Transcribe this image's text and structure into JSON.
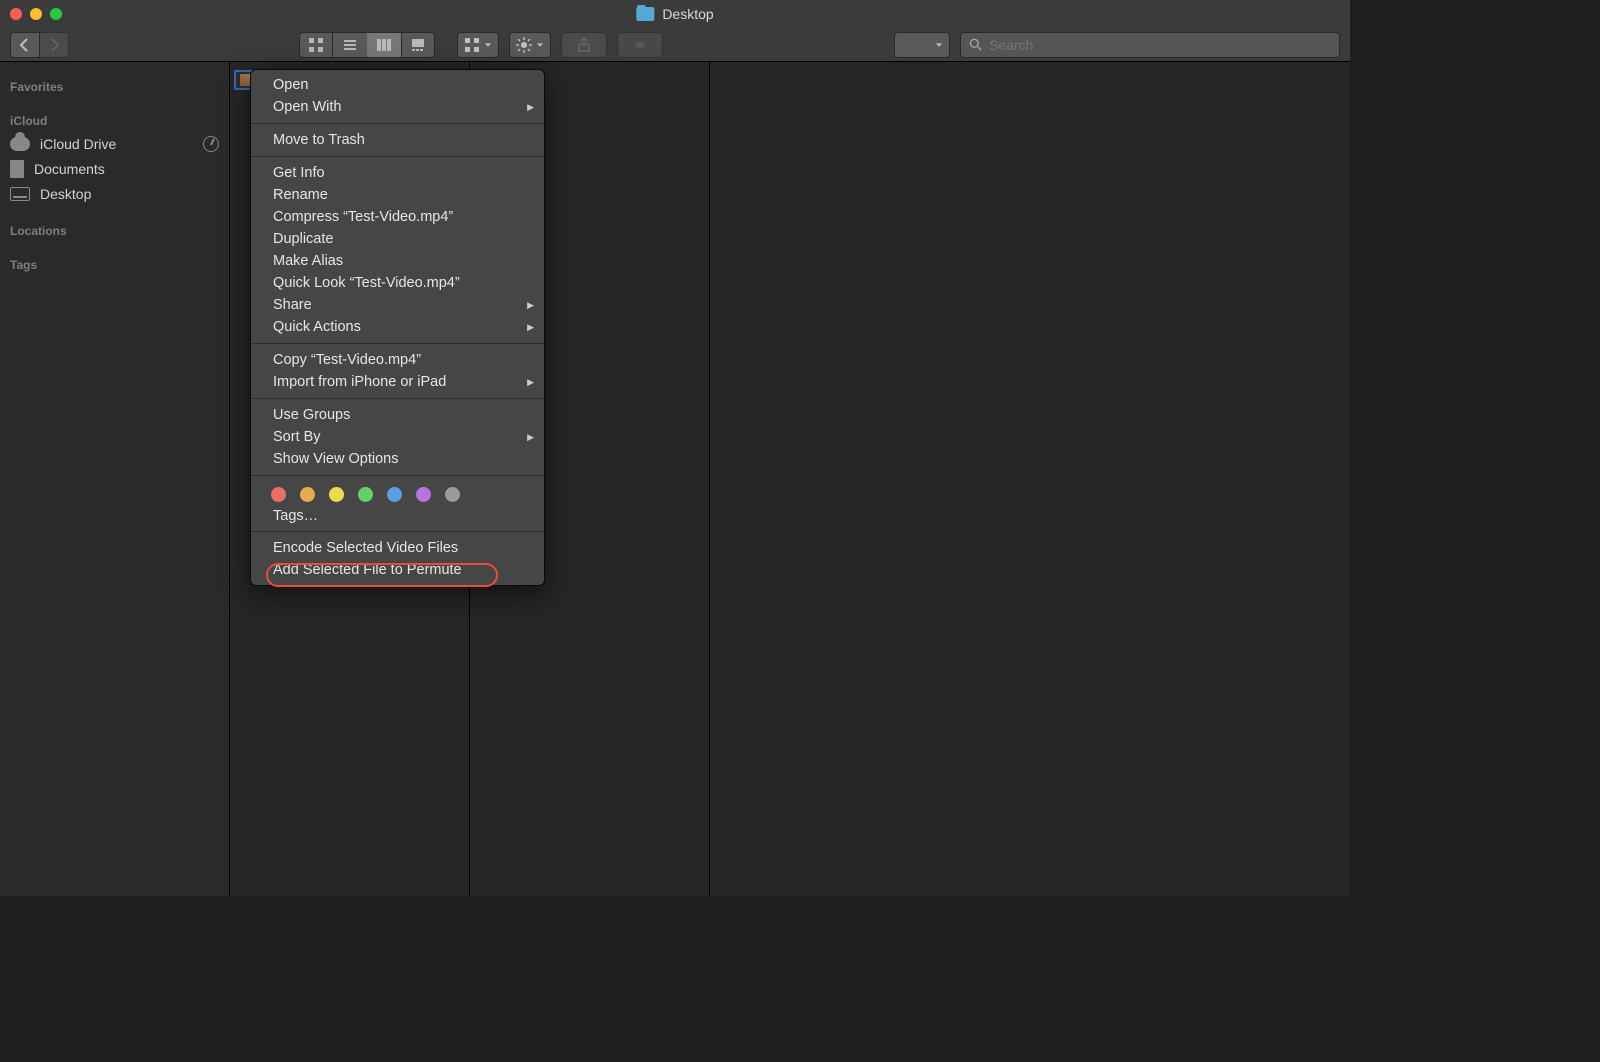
{
  "window_title": "Desktop",
  "traffic_colors": {
    "close": "#ff5f57",
    "min": "#febc2e",
    "max": "#28c840"
  },
  "search_placeholder": "Search",
  "sidebar": {
    "sections": [
      {
        "label": "Favorites",
        "items": []
      },
      {
        "label": "iCloud",
        "items": [
          {
            "label": "iCloud Drive",
            "icon": "cloud",
            "status": "progress"
          },
          {
            "label": "Documents",
            "icon": "doc"
          },
          {
            "label": "Desktop",
            "icon": "desk"
          }
        ]
      },
      {
        "label": "Locations",
        "items": []
      },
      {
        "label": "Tags",
        "items": []
      }
    ]
  },
  "selected_file": "Test-Video.mp4",
  "context_menu": {
    "groups": [
      [
        {
          "label": "Open"
        },
        {
          "label": "Open With",
          "submenu": true
        }
      ],
      [
        {
          "label": "Move to Trash"
        }
      ],
      [
        {
          "label": "Get Info"
        },
        {
          "label": "Rename"
        },
        {
          "label": "Compress “Test-Video.mp4”"
        },
        {
          "label": "Duplicate"
        },
        {
          "label": "Make Alias"
        },
        {
          "label": "Quick Look “Test-Video.mp4”"
        },
        {
          "label": "Share",
          "submenu": true
        },
        {
          "label": "Quick Actions",
          "submenu": true
        }
      ],
      [
        {
          "label": "Copy “Test-Video.mp4”"
        },
        {
          "label": "Import from iPhone or iPad",
          "submenu": true
        }
      ],
      [
        {
          "label": "Use Groups"
        },
        {
          "label": "Sort By",
          "submenu": true
        },
        {
          "label": "Show View Options"
        }
      ]
    ],
    "tag_colors": [
      "#e86f67",
      "#eba94e",
      "#ebda4e",
      "#65cf6a",
      "#5a9ee6",
      "#b973e0",
      "#9a9a9a"
    ],
    "tags_label": "Tags…",
    "footer": [
      {
        "label": "Encode Selected Video Files",
        "highlighted": true
      },
      {
        "label": "Add Selected File to Permute"
      }
    ]
  }
}
